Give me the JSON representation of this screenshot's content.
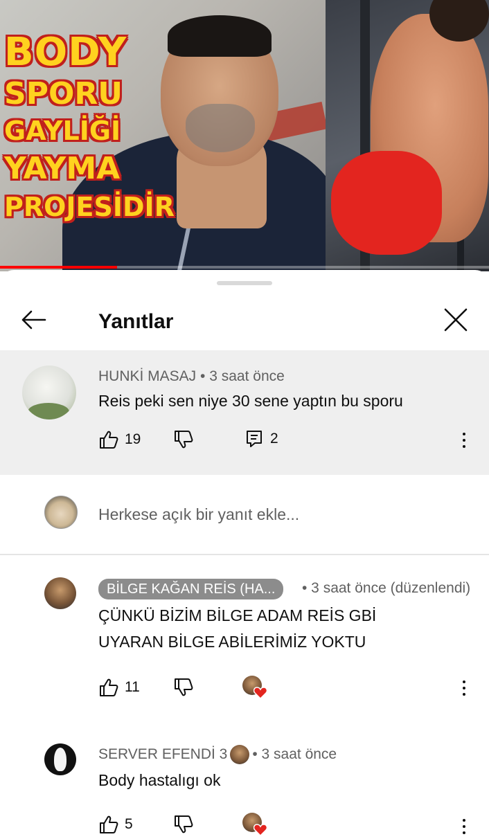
{
  "thumbnail": {
    "lines": [
      "BODY",
      "SPORU",
      "GAYLİĞİ",
      "YAYMA",
      "PROJESİDİR"
    ],
    "progress_fraction": 0.24
  },
  "sheet": {
    "title": "Yanıtlar",
    "back_icon": "arrow-left-icon",
    "close_icon": "close-icon"
  },
  "parent_comment": {
    "author": "HUNKİ MASAJ",
    "time": "• 3 saat önce",
    "text": "Reis peki sen niye 30 sene yaptın bu sporu",
    "likes": "19",
    "replies": "2"
  },
  "reply_input": {
    "placeholder": "Herkese açık bir yanıt ekle..."
  },
  "replies": [
    {
      "author": "BİLGE KAĞAN REİS (HA...",
      "time": "• 3 saat önce (düzenlendi)",
      "line1": "ÇÜNKÜ BİZİM BİLGE ADAM REİS GBİ",
      "line2": "UYARAN BİLGE ABİLERİMİZ YOKTU",
      "likes": "11"
    },
    {
      "author": "SERVER EFENDİ 3",
      "time": "• 3 saat önce",
      "text": "Body hastalıgı ok",
      "likes": "5"
    }
  ],
  "colors": {
    "progress": "#ff0000",
    "heart": "#e3251f",
    "thumb_text": "#ffd21f",
    "thumb_outline": "#c0201c"
  }
}
